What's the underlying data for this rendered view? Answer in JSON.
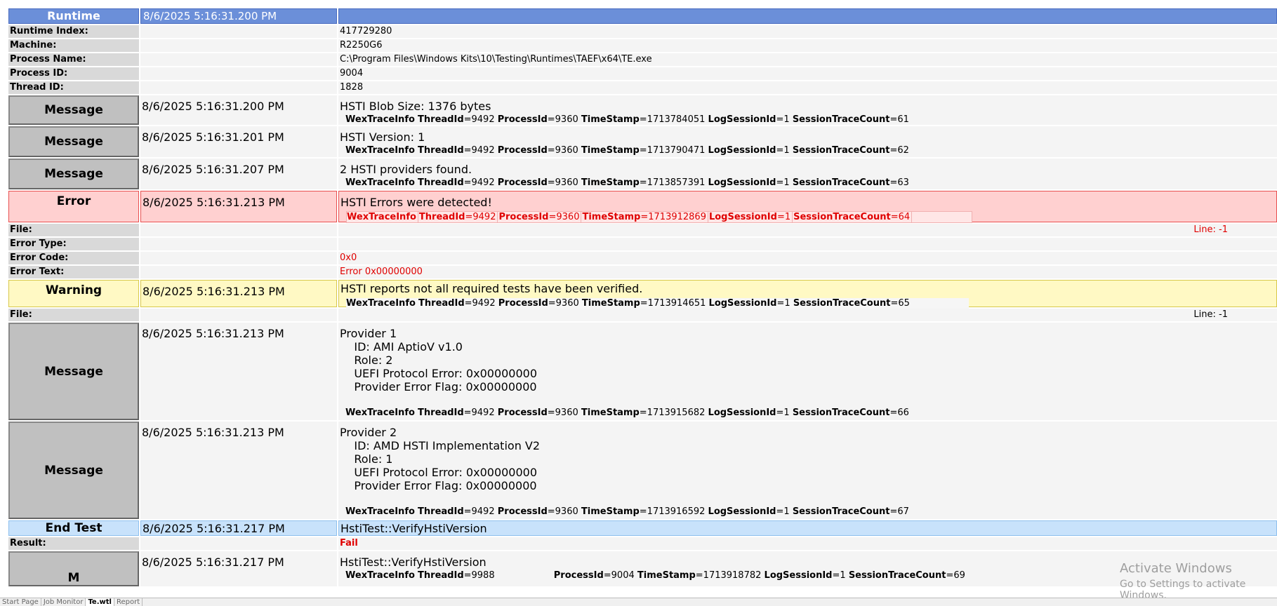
{
  "runtime": {
    "label": "Runtime",
    "timestamp": "8/6/2025 5:16:31.200 PM"
  },
  "props": [
    {
      "label": "Runtime Index:",
      "value": "417729280"
    },
    {
      "label": "Machine:",
      "value": "R2250G6"
    },
    {
      "label": "Process Name:",
      "value": "C:\\Program Files\\Windows Kits\\10\\Testing\\Runtimes\\TAEF\\x64\\TE.exe"
    },
    {
      "label": "Process ID:",
      "value": "9004"
    },
    {
      "label": "Thread ID:",
      "value": "1828"
    }
  ],
  "trace_keys": {
    "wex": "WexTraceInfo",
    "thread": "ThreadId",
    "process": "ProcessId",
    "ts": "TimeStamp",
    "session": "LogSessionId",
    "count": "SessionTraceCount"
  },
  "entries": [
    {
      "type": "Message",
      "time": "8/6/2025 5:16:31.200 PM",
      "text": "HSTI Blob Size: 1376 bytes",
      "trace": {
        "thread": "=9492",
        "process": "=9360",
        "ts": "=1713784051",
        "session": "=1",
        "count": "=61"
      }
    },
    {
      "type": "Message",
      "time": "8/6/2025 5:16:31.201 PM",
      "text": "HSTI Version: 1",
      "trace": {
        "thread": "=9492",
        "process": "=9360",
        "ts": "=1713790471",
        "session": "=1",
        "count": "=62"
      }
    },
    {
      "type": "Message",
      "time": "8/6/2025 5:16:31.207 PM",
      "text": "2 HSTI providers found.",
      "trace": {
        "thread": "=9492",
        "process": "=9360",
        "ts": "=1713857391",
        "session": "=1",
        "count": "=63"
      }
    },
    {
      "type": "Error",
      "time": "8/6/2025 5:16:31.213 PM",
      "text": "HSTI Errors were detected!",
      "trace": {
        "thread": "=9492",
        "process": "=9360",
        "ts": "=1713912869",
        "session": "=1",
        "count": "=64"
      }
    },
    {
      "type": "Warning",
      "time": "8/6/2025 5:16:31.213 PM",
      "text": "HSTI reports not all required tests have been verified.",
      "trace": {
        "thread": "=9492",
        "process": "=9360",
        "ts": "=1713914651",
        "session": "=1",
        "count": "=65"
      }
    },
    {
      "type": "Message",
      "time": "8/6/2025 5:16:31.213 PM",
      "text": "Provider 1\n    ID: AMI AptioV v1.0\n    Role: 2\n    UEFI Protocol Error: 0x00000000\n    Provider Error Flag: 0x00000000\n ",
      "trace": {
        "thread": "=9492",
        "process": "=9360",
        "ts": "=1713915682",
        "session": "=1",
        "count": "=66"
      }
    },
    {
      "type": "Message",
      "time": "8/6/2025 5:16:31.213 PM",
      "text": "Provider 2\n    ID: AMD HSTI Implementation V2\n    Role: 1\n    UEFI Protocol Error: 0x00000000\n    Provider Error Flag: 0x00000000\n ",
      "trace": {
        "thread": "=9492",
        "process": "=9360",
        "ts": "=1713916592",
        "session": "=1",
        "count": "=67"
      }
    },
    {
      "type": "End Test",
      "time": "8/6/2025 5:16:31.217 PM",
      "text": "HstiTest::VerifyHstiVersion"
    },
    {
      "type": "Message",
      "time": "8/6/2025 5:16:31.217 PM",
      "text": "HstiTest::VerifyHstiVersion",
      "trace": {
        "thread": "=9988",
        "process": "=9004",
        "ts": "=1713918782",
        "session": "=1",
        "count": "=69"
      }
    }
  ],
  "error_details": {
    "file_label": "File:",
    "line": "Line: -1",
    "error_type_label": "Error Type:",
    "error_type": "",
    "error_code_label": "Error Code:",
    "error_code": "0x0",
    "error_text_label": "Error Text:",
    "error_text": "Error 0x00000000"
  },
  "warning_details": {
    "file_label": "File:",
    "line": "Line: -1"
  },
  "result": {
    "label": "Result:",
    "value": "Fail"
  },
  "last_entry_partial_label": "M",
  "watermark": {
    "line1": "Activate Windows",
    "line2": "Go to Settings to activate Windows."
  },
  "tabs": [
    "Start Page",
    "Job Monitor",
    "Te.wtl",
    "Report"
  ],
  "colors": {
    "header": "#6b8fd9",
    "error": "#ffd0d0",
    "warning": "#fff9c4",
    "end_test": "#c8e2fb",
    "fail": "#e00000"
  }
}
